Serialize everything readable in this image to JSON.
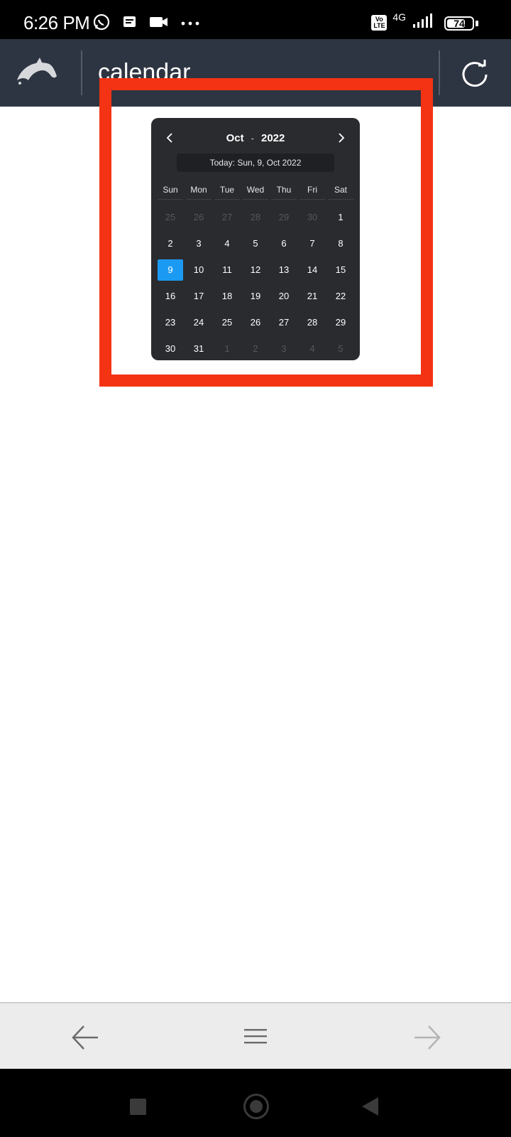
{
  "status_bar": {
    "time": "6:26 PM",
    "network": "4G",
    "volte": "Vo LTE",
    "battery": "74",
    "battery_level_percent": 74
  },
  "browser": {
    "url_text": "calendar"
  },
  "calendar": {
    "month": "Oct",
    "separator": "-",
    "year": "2022",
    "today_label": "Today: Sun, 9, Oct 2022",
    "weekdays": [
      "Sun",
      "Mon",
      "Tue",
      "Wed",
      "Thu",
      "Fri",
      "Sat"
    ],
    "days": [
      {
        "label": "25",
        "muted": true
      },
      {
        "label": "26",
        "muted": true
      },
      {
        "label": "27",
        "muted": true
      },
      {
        "label": "28",
        "muted": true
      },
      {
        "label": "29",
        "muted": true
      },
      {
        "label": "30",
        "muted": true
      },
      {
        "label": "1",
        "muted": false
      },
      {
        "label": "2",
        "muted": false
      },
      {
        "label": "3",
        "muted": false
      },
      {
        "label": "4",
        "muted": false
      },
      {
        "label": "5",
        "muted": false
      },
      {
        "label": "6",
        "muted": false
      },
      {
        "label": "7",
        "muted": false
      },
      {
        "label": "8",
        "muted": false
      },
      {
        "label": "9",
        "muted": false,
        "selected": true
      },
      {
        "label": "10",
        "muted": false
      },
      {
        "label": "11",
        "muted": false
      },
      {
        "label": "12",
        "muted": false
      },
      {
        "label": "13",
        "muted": false
      },
      {
        "label": "14",
        "muted": false
      },
      {
        "label": "15",
        "muted": false
      },
      {
        "label": "16",
        "muted": false
      },
      {
        "label": "17",
        "muted": false
      },
      {
        "label": "18",
        "muted": false
      },
      {
        "label": "19",
        "muted": false
      },
      {
        "label": "20",
        "muted": false
      },
      {
        "label": "21",
        "muted": false
      },
      {
        "label": "22",
        "muted": false
      },
      {
        "label": "23",
        "muted": false
      },
      {
        "label": "24",
        "muted": false
      },
      {
        "label": "25",
        "muted": false
      },
      {
        "label": "26",
        "muted": false
      },
      {
        "label": "27",
        "muted": false
      },
      {
        "label": "28",
        "muted": false
      },
      {
        "label": "29",
        "muted": false
      },
      {
        "label": "30",
        "muted": false
      },
      {
        "label": "31",
        "muted": false
      },
      {
        "label": "1",
        "muted": true
      },
      {
        "label": "2",
        "muted": true
      },
      {
        "label": "3",
        "muted": true
      },
      {
        "label": "4",
        "muted": true
      },
      {
        "label": "5",
        "muted": true
      }
    ]
  },
  "colors": {
    "toolbar": "#2e3542",
    "calendar_bg": "#2a2b2f",
    "selected_day": "#1b9af4",
    "highlight_box": "#f33313"
  },
  "icons": {
    "status_left": [
      "whatsapp-icon",
      "message-icon",
      "video-icon",
      "more-dots-icon"
    ],
    "toolbar": [
      "dolphin-logo-icon",
      "reload-icon"
    ],
    "bottom": [
      "back-arrow-icon",
      "menu-icon",
      "forward-arrow-icon"
    ]
  }
}
